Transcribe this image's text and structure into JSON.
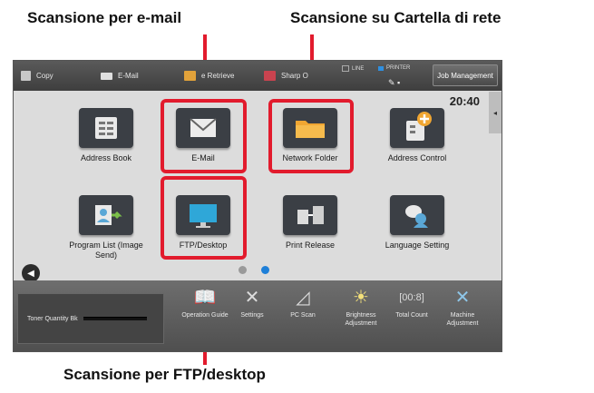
{
  "callouts": {
    "email": "Scansione per e-mail",
    "network_folder": "Scansione su Cartella di rete",
    "ftp": "Scansione per FTP/desktop"
  },
  "topbar": {
    "shortcuts": [
      "Copy",
      "E-Mail",
      "e Retrieve",
      "Sharp O"
    ],
    "status_line": "LINE",
    "status_printer": "PRINTER",
    "job_button": "Job Management"
  },
  "clock": "20:40",
  "tiles": [
    {
      "label": "Address Book",
      "icon": "address-book-icon"
    },
    {
      "label": "E-Mail",
      "icon": "envelope-icon"
    },
    {
      "label": "Network Folder",
      "icon": "folder-icon"
    },
    {
      "label": "Address Control",
      "icon": "address-control-icon"
    },
    {
      "label": "Program List (Image Send)",
      "icon": "program-list-icon"
    },
    {
      "label": "FTP/Desktop",
      "icon": "monitor-icon"
    },
    {
      "label": "Print Release",
      "icon": "print-release-icon"
    },
    {
      "label": "Language Setting",
      "icon": "language-icon"
    }
  ],
  "toner_label": "Toner Quantity  Bk",
  "tools": [
    {
      "label": "Operation Guide",
      "icon": "operation-guide-icon"
    },
    {
      "label": "Settings",
      "icon": "settings-icon"
    },
    {
      "label": "PC Scan",
      "icon": "pc-scan-icon"
    },
    {
      "label": "Brightness Adjustment",
      "icon": "brightness-icon"
    },
    {
      "label": "Total Count",
      "icon": "total-count-icon"
    },
    {
      "label": "Machine Adjustment",
      "icon": "machine-adjustment-icon"
    }
  ],
  "colors": {
    "highlight": "#e21b2d",
    "active_page": "#1e7fd8",
    "inactive_page": "#9a9a9a"
  }
}
